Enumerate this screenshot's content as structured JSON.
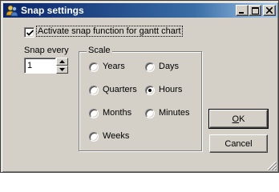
{
  "window": {
    "title": "Snap settings",
    "icon": "app-people-icon",
    "controls": [
      "minimize-icon",
      "maximize-icon",
      "close-icon"
    ]
  },
  "snap_checkbox": {
    "label": "Activate snap function for gantt chart",
    "checked": true
  },
  "snap_every": {
    "label": "Snap every",
    "value": "1"
  },
  "scale": {
    "legend": "Scale",
    "options": [
      {
        "label": "Years",
        "selected": false
      },
      {
        "label": "Days",
        "selected": false
      },
      {
        "label": "Quarters",
        "selected": false
      },
      {
        "label": "Hours",
        "selected": true
      },
      {
        "label": "Months",
        "selected": false
      },
      {
        "label": "Minutes",
        "selected": false
      },
      {
        "label": "Weeks",
        "selected": false
      }
    ]
  },
  "buttons": {
    "ok_label": "OK",
    "cancel_label": "Cancel"
  },
  "colors": {
    "face": "#d4d0c8",
    "title_start": "#0a246a",
    "title_end": "#a6caf0"
  }
}
